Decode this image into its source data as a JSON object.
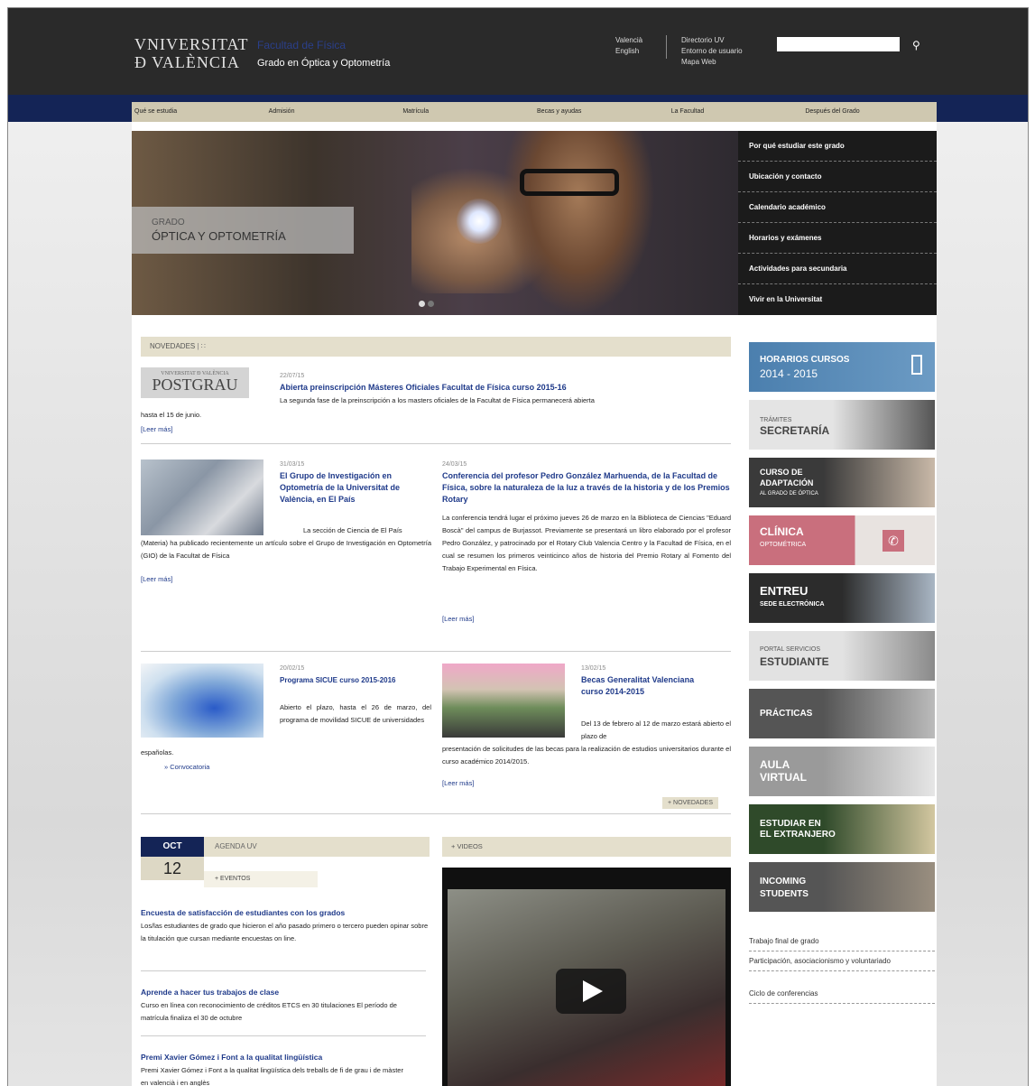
{
  "header": {
    "logo_line1": "VNIVERSITAT",
    "logo_line2": "Ð VALÈNCIA",
    "faculty": "Facultad de Física",
    "degree": "Grado en Óptica y Optometría",
    "languages": [
      "Valencià",
      "English"
    ],
    "links": [
      "Directorio UV",
      "Entorno de usuario",
      "Mapa Web"
    ],
    "search_placeholder": ""
  },
  "nav": {
    "items": [
      "Qué se estudia",
      "Admisión",
      "Matrícula",
      "Becas y ayudas",
      "La Facultad",
      "Después del Grado"
    ]
  },
  "hero": {
    "caption_small": "GRADO",
    "caption_big": "ÓPTICA Y OPTOMETRÍA",
    "menu": [
      "Por qué estudiar este grado",
      "Ubicación y contacto",
      "Calendario académico",
      "Horarios y exámenes",
      "Actividades para secundaria",
      "Vivir en la Universitat"
    ]
  },
  "news": {
    "header": "NOVEDADES",
    "rss_icon": "rss-icon",
    "postgrau_small": "VNIVERSITAT Ð VALÈNCIA",
    "postgrau_big": "POSTGRAU",
    "items": [
      {
        "date": "22/07/15",
        "title": "Abierta preinscripción Másteres Oficiales Facultat de Física curso 2015-16",
        "text1": "La segunda fase de la preinscripción a los masters oficiales de la Facultat de Física permanecerá abierta",
        "text2": "hasta el 15 de junio.",
        "more": "[Leer más]"
      },
      {
        "date": "31/03/15",
        "title": "El Grupo de Investigación en Optometría de la Universitat de València, en El País",
        "text1": "La sección de Ciencia de El País",
        "text2": "(Materia) ha publicado recientemente un artículo sobre el Grupo de Investigación en Optometría (GIO) de la Facultat de Física",
        "more": "[Leer más]"
      },
      {
        "date": "24/03/15",
        "title": "Conferencia del profesor Pedro González Marhuenda, de la Facultad de Física, sobre la naturaleza de la luz a través de la historia y de los Premios Rotary",
        "text1": "La conferencia tendrá lugar el próximo jueves 26 de marzo en la Biblioteca de Ciencias \"Eduard Boscà\" del campus de Burjassot. Previamente se presentará un libro elaborado por el profesor Pedro González, y patrocinado por el Rotary Club Valencia Centro y la Facultad de Física, en el cual se resumen los primeros veinticinco años de historia del Premio Rotary al Fomento del Trabajo Experimental en Física.",
        "more": "[Leer más]"
      },
      {
        "date": "20/02/15",
        "title": "Programa SICUE curso 2015-2016",
        "text1": "Abierto el plazo, hasta el 26 de marzo, del programa de movilidad SICUE de universidades",
        "text2": "españolas.",
        "more": "»  Convocatoria"
      },
      {
        "date": "13/02/15",
        "title": "Becas Generalitat Valenciana curso 2014-2015",
        "text1": "Del 13 de febrero al 12 de marzo estará abierto el plazo de",
        "text2": "presentación de solicitudes de las becas para la realización de estudios universitarios durante el curso académico 2014/2015.",
        "more": "[Leer más]"
      }
    ],
    "more_news": "+ NOVEDADES"
  },
  "agenda": {
    "month": "OCT",
    "day": "12",
    "title": "AGENDA UV",
    "events_link": "+ EVENTOS",
    "items": [
      {
        "title": "Encuesta de satisfacción de estudiantes con los grados",
        "text": "Los/las estudiantes de grado que hicieron el año pasado primero o tercero pueden opinar sobre la titulación que cursan mediante encuestas on line."
      },
      {
        "title": "Aprende a hacer tus trabajos de clase",
        "text": "Curso en línea con reconocimiento de créditos ETCS en 30 titulaciones El período de matrícula finaliza el 30 de octubre"
      },
      {
        "title": "Premi Xavier Gómez i Font a la qualitat lingüística",
        "text": "Premi Xavier Gómez i Font a la qualitat lingüística dels treballs de fi de grau i de màster en valencià i en anglès"
      }
    ]
  },
  "videos": {
    "title": "+ VIDEOS",
    "play_icon": "play-icon"
  },
  "sidebar": {
    "banners": [
      {
        "title": "HORARIOS CURSOS",
        "subtitle": "2014 - 2015",
        "color": "#4b7fae"
      },
      {
        "title": "TRÁMITES",
        "subtitle": "SECRETARÍA",
        "color": "#d6d6d6"
      },
      {
        "title": "CURSO DE ADAPTACIÓN",
        "subtitle": "AL GRADO DE ÓPTICA",
        "color": "#3c3c3c"
      },
      {
        "title": "CLÍNICA",
        "subtitle": "OPTOMÉTRICA",
        "color": "#c96f7d"
      },
      {
        "title": "ENTREU",
        "subtitle": "SEDE ELECTRÓNICA",
        "color": "#2c2c2c"
      },
      {
        "title": "PORTAL SERVICIOS",
        "subtitle": "ESTUDIANTE",
        "color": "#d9d9d9"
      },
      {
        "title": "PRÁCTICAS",
        "subtitle": "",
        "color": "#555555"
      },
      {
        "title": "AULA",
        "subtitle": "VIRTUAL",
        "color": "#9a9a9a"
      },
      {
        "title": "ESTUDIAR EN",
        "subtitle": "EL EXTRANJERO",
        "color": "#2f4a2a"
      },
      {
        "title": "INCOMING",
        "subtitle": "STUDENTS",
        "color": "#555"
      }
    ],
    "links": [
      "Trabajo final de grado",
      "Participación, asociacionismo y voluntariado",
      "Ciclo de conferencias"
    ]
  }
}
